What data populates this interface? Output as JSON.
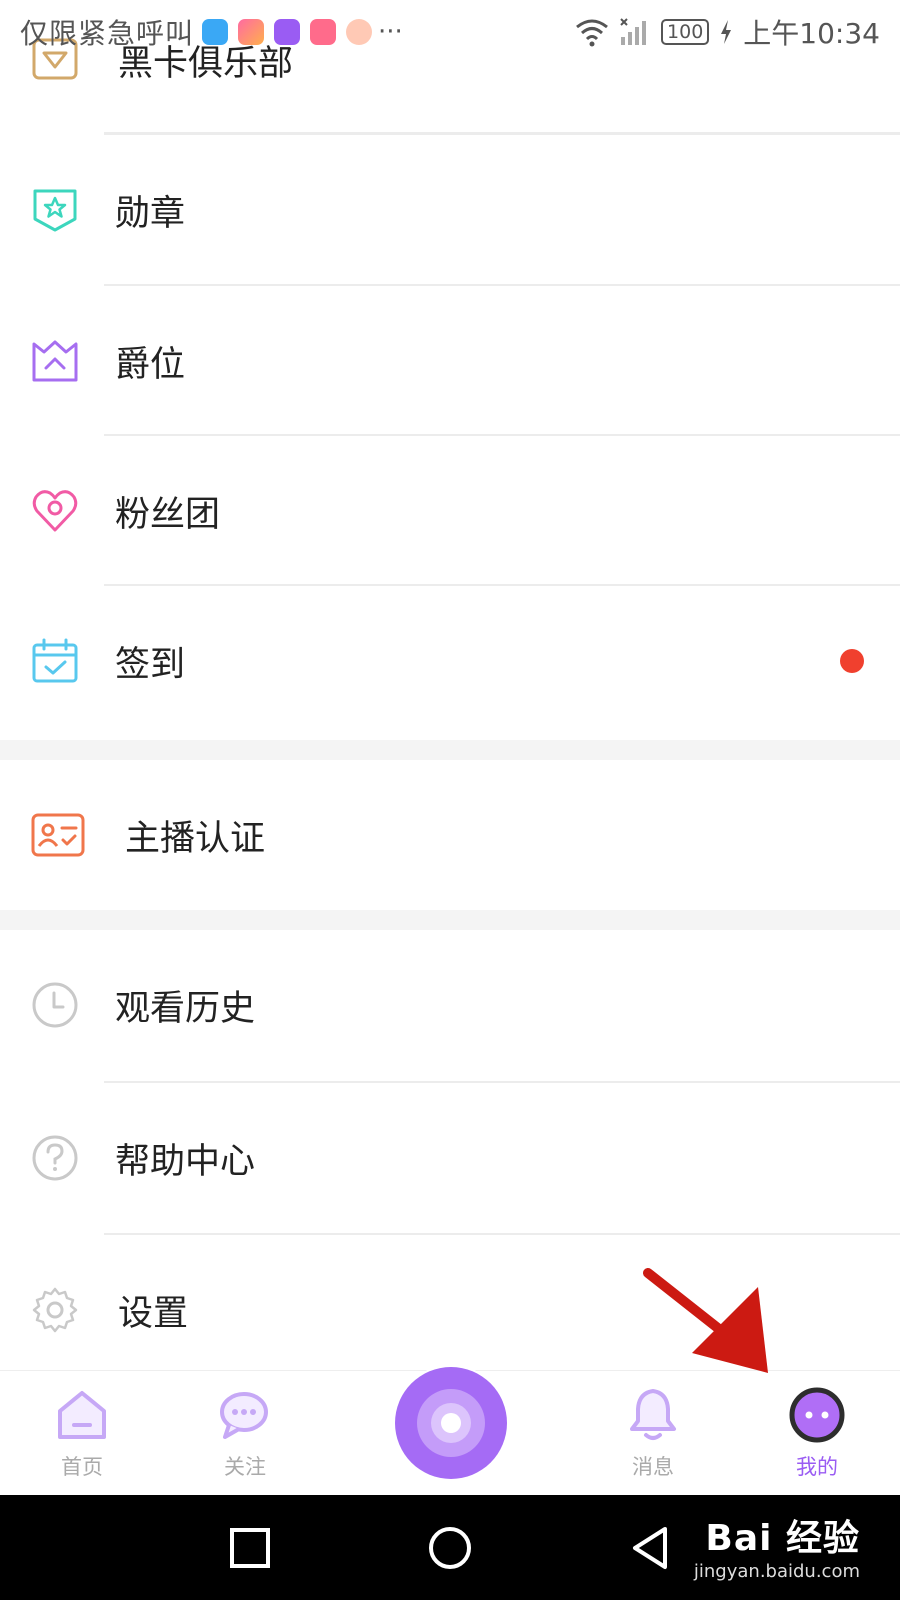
{
  "status_bar": {
    "left_text": "仅限紧急呼叫",
    "more": "···",
    "battery": "100",
    "time": "上午10:34"
  },
  "menu": {
    "items": [
      {
        "label": "黑卡俱乐部",
        "icon": "diamond-card-icon",
        "color": "#d2a86a"
      },
      {
        "label": "勋章",
        "icon": "star-badge-icon",
        "color": "#3cd6bd"
      },
      {
        "label": "爵位",
        "icon": "crown-icon",
        "color": "#a66ef0"
      },
      {
        "label": "粉丝团",
        "icon": "heart-icon",
        "color": "#f15ba5"
      },
      {
        "label": "签到",
        "icon": "calendar-check-icon",
        "color": "#58c8ee",
        "badge": "red-dot"
      },
      {
        "label": "主播认证",
        "icon": "id-card-icon",
        "color": "#f0764b"
      },
      {
        "label": "观看历史",
        "icon": "clock-icon",
        "color": "#c9c9c9"
      },
      {
        "label": "帮助中心",
        "icon": "help-circle-icon",
        "color": "#c9c9c9"
      },
      {
        "label": "设置",
        "icon": "gear-icon",
        "color": "#c9c9c9"
      }
    ]
  },
  "bottom_nav": {
    "tabs": [
      {
        "label": "首页",
        "icon": "home-icon"
      },
      {
        "label": "关注",
        "icon": "chat-bubble-icon"
      },
      {
        "label": "消息",
        "icon": "bell-icon"
      },
      {
        "label": "我的",
        "icon": "profile-face-icon",
        "active": true
      }
    ],
    "center": "live-disc-icon",
    "accent": "#9a5cf3"
  },
  "system_nav": {
    "buttons": [
      "square-icon",
      "circle-icon",
      "back-triangle-icon"
    ]
  },
  "watermark": {
    "brand": "Bai 经验",
    "url": "jingyan.baidu.com"
  }
}
